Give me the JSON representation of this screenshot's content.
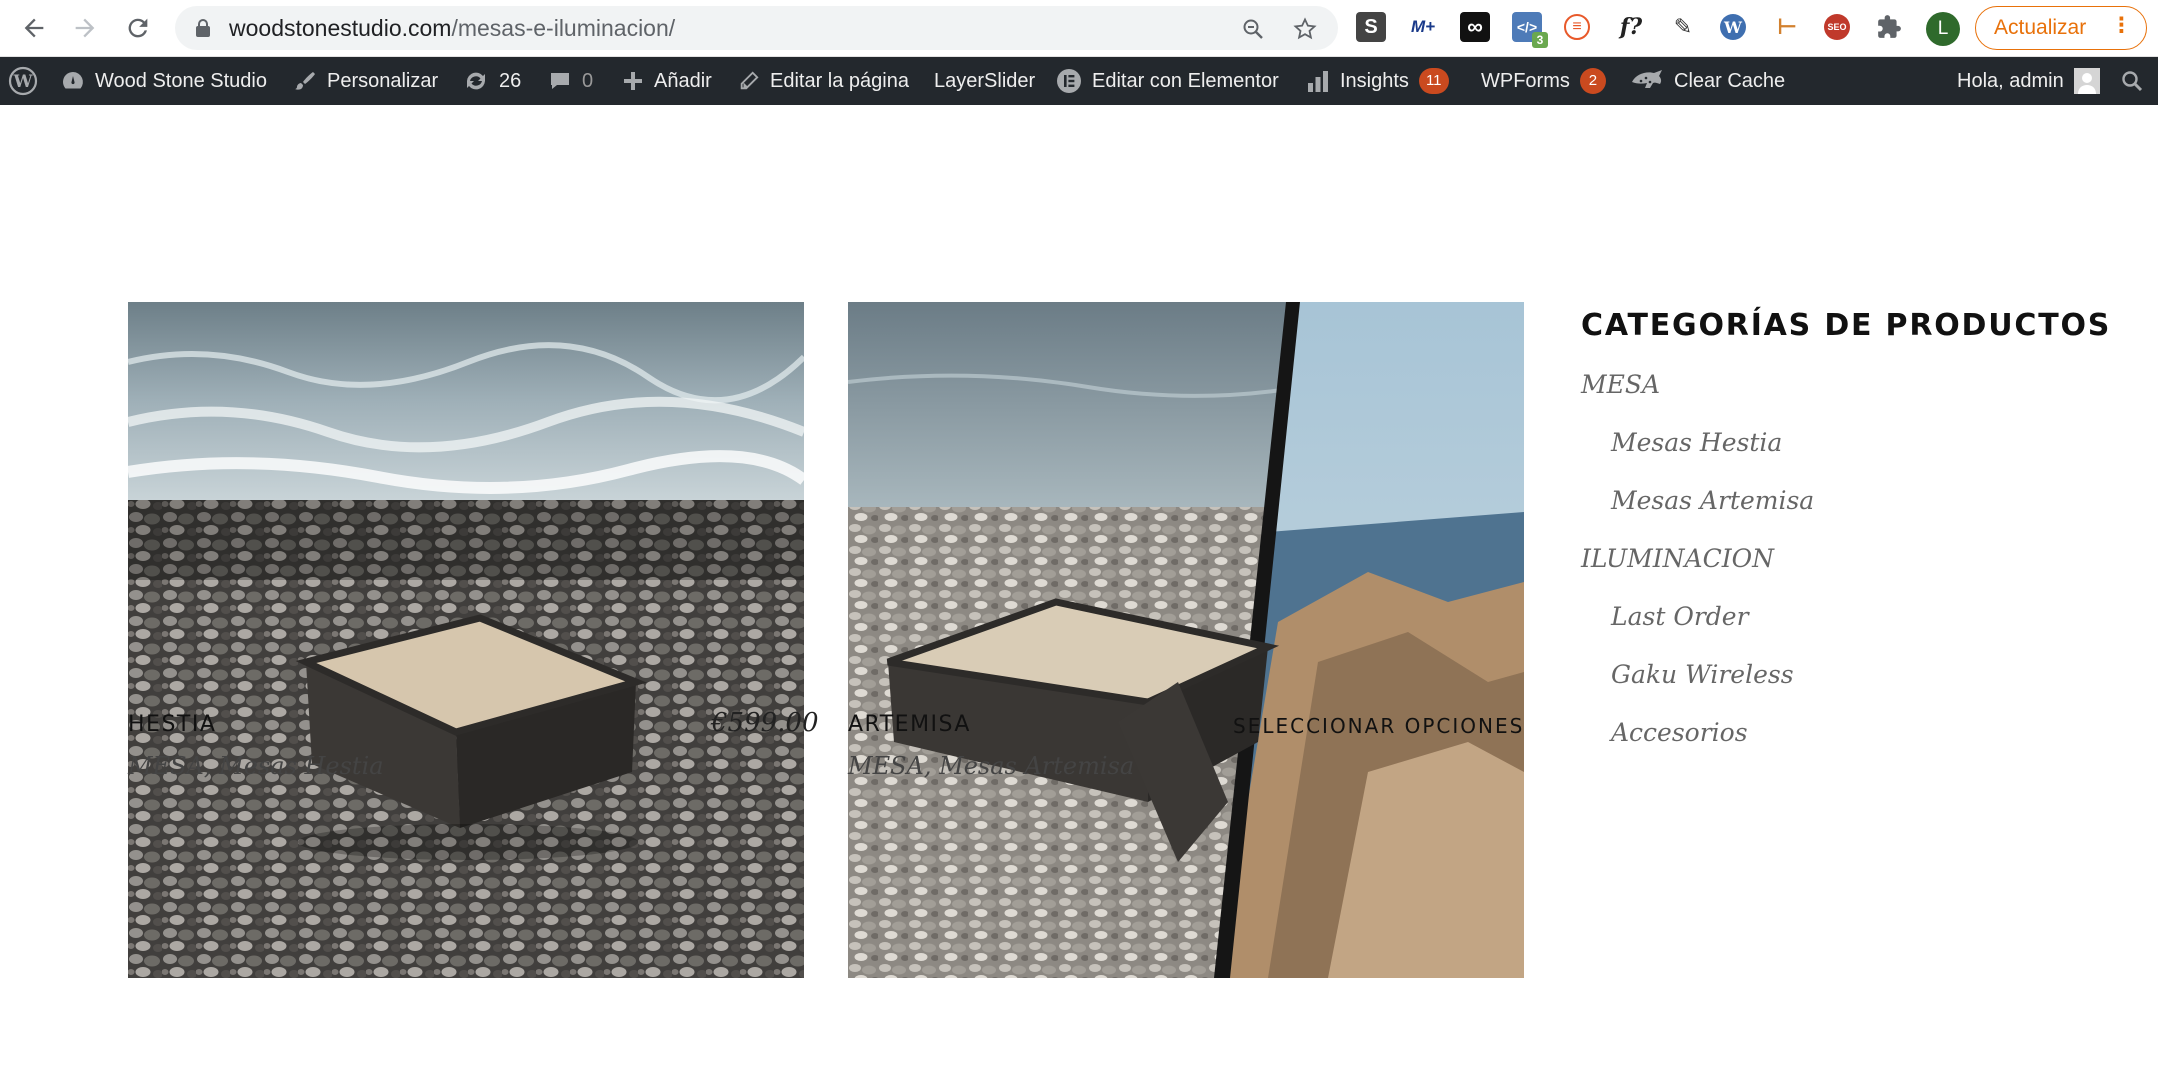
{
  "browser": {
    "url_domain": "woodstonestudio.com",
    "url_path": "/mesas-e-iluminacion/",
    "profile_initial": "L",
    "update_label": "Actualizar",
    "update_menu": "⋮",
    "extensions": [
      "S",
      "M+",
      "∞",
      "</>",
      "≡",
      "f?",
      "✎",
      "W",
      "⊢",
      "SEO",
      "puzzle"
    ],
    "extension_badge": "3",
    "accent_color": "#e8710a"
  },
  "admin_bar": {
    "site_name": "Wood Stone Studio",
    "customize": "Personalizar",
    "updates_count": "26",
    "comments_count": "0",
    "new": "Añadir",
    "edit_page": "Editar la página",
    "layerslider": "LayerSlider",
    "elementor": "Editar con Elementor",
    "insights": "Insights",
    "insights_count": "11",
    "wpforms": "WPForms",
    "wpforms_count": "2",
    "clear_cache": "Clear Cache",
    "greeting": "Hola, admin",
    "bar_color": "#23282d",
    "badge_color": "#ca4a1f"
  },
  "products": [
    {
      "name": "HESTIA",
      "categories": "MESA, Mesas Hestia",
      "price": "€599.00",
      "action": ""
    },
    {
      "name": "ARTEMISA",
      "categories": "MESA, Mesas Artemisa",
      "price": "",
      "action": "SELECCIONAR OPCIONES"
    }
  ],
  "sidebar": {
    "title": "CATEGORÍAS DE PRODUCTOS",
    "categories": [
      {
        "label": "MESA",
        "level": 0
      },
      {
        "label": "Mesas Hestia",
        "level": 1
      },
      {
        "label": "Mesas Artemisa",
        "level": 1
      },
      {
        "label": "ILUMINACION",
        "level": 0
      },
      {
        "label": "Last Order",
        "level": 1
      },
      {
        "label": "Gaku Wireless",
        "level": 1
      },
      {
        "label": "Accesorios",
        "level": 1
      }
    ]
  }
}
